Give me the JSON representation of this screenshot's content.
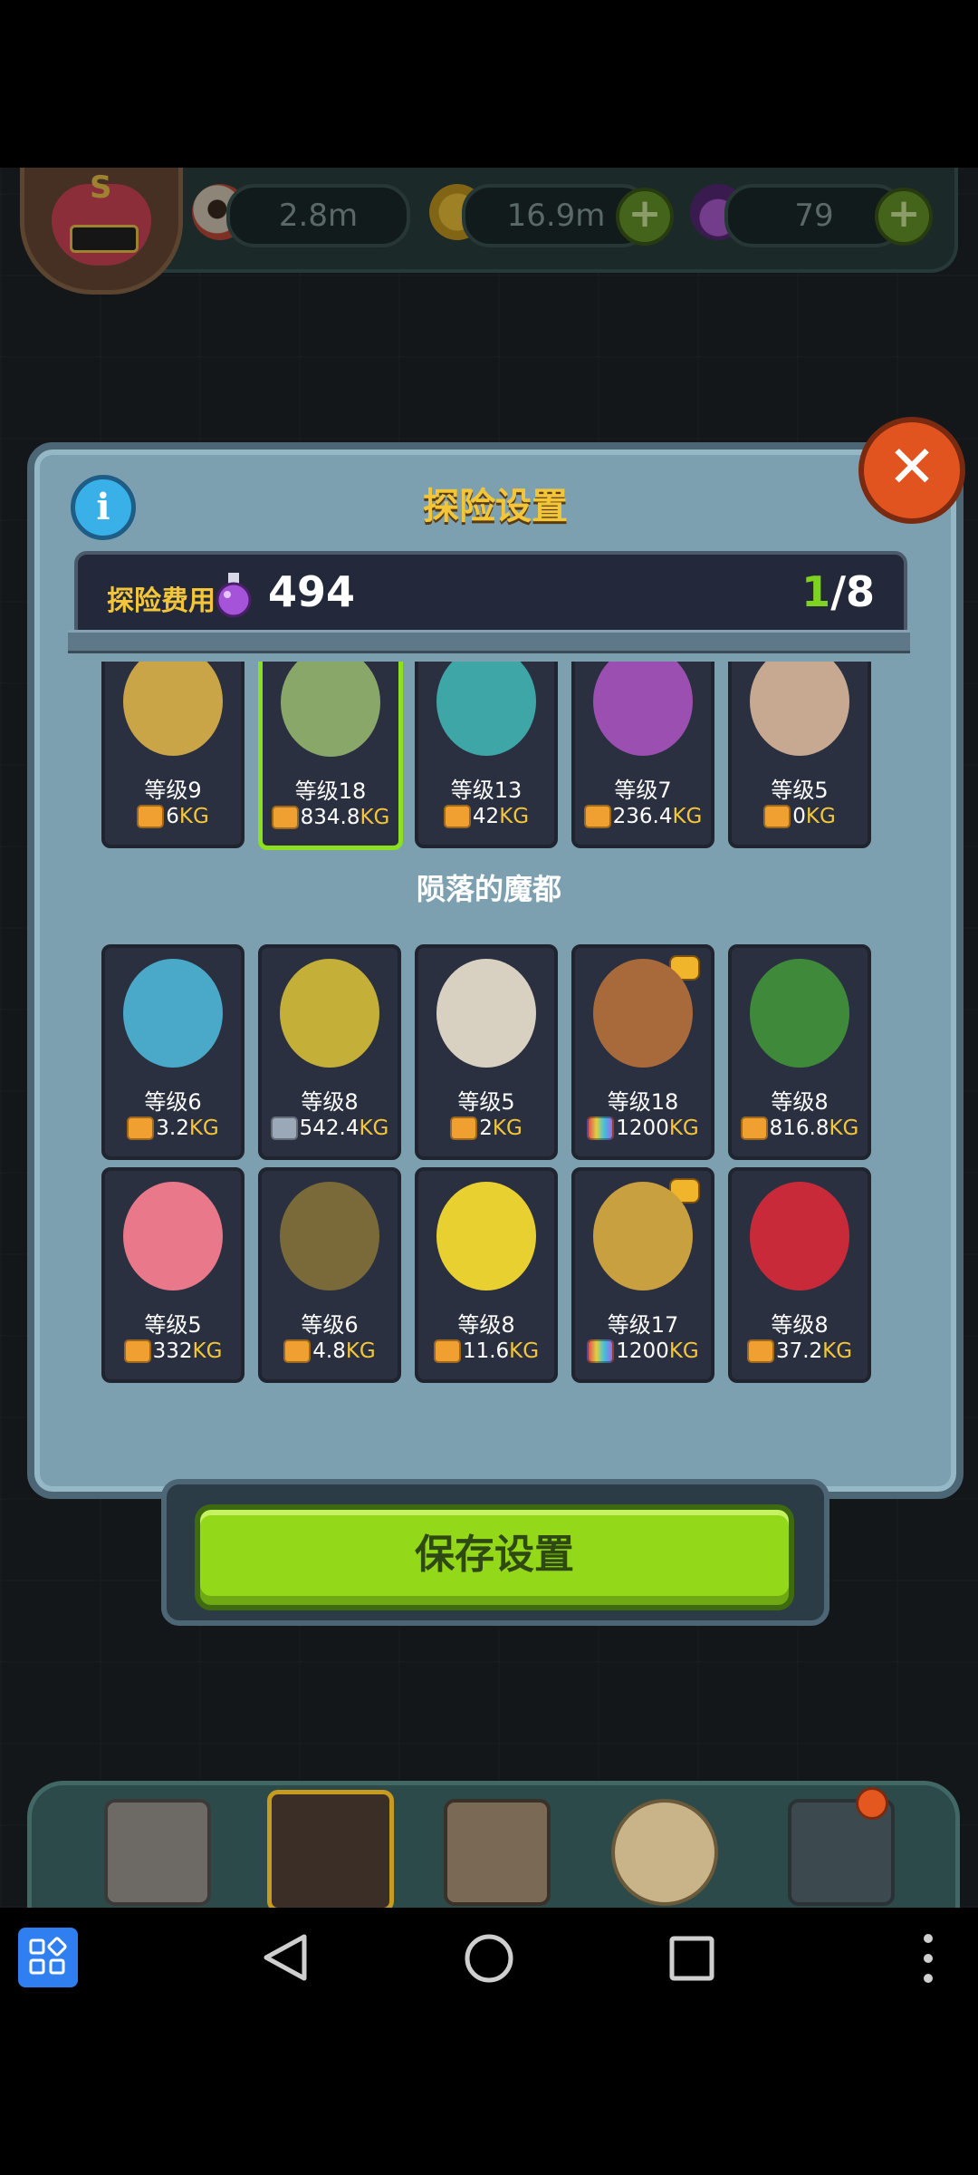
{
  "topbar": {
    "eye_value": "2.8m",
    "coin_value": "16.9m",
    "potion_value": "79",
    "plus_symbol": "+"
  },
  "dialog": {
    "title": "探险设置",
    "info_symbol": "i",
    "close_symbol": "✕",
    "cost_label": "探险费用",
    "cost_value": "494",
    "slots_used": "1",
    "slots_total": "/8",
    "save_button": "保存设置"
  },
  "top_row": [
    {
      "level": "等级9",
      "weight": "6",
      "unit": "KG",
      "bag": "#f0a030",
      "color": "#c9a548",
      "selected": false
    },
    {
      "level": "等级18",
      "weight": "834.8",
      "unit": "KG",
      "bag": "#f0a030",
      "color": "#8aa76a",
      "selected": true
    },
    {
      "level": "等级13",
      "weight": "42",
      "unit": "KG",
      "bag": "#f0a030",
      "color": "#3fa6a8",
      "selected": false
    },
    {
      "level": "等级7",
      "weight": "236.4",
      "unit": "KG",
      "bag": "#f0a030",
      "color": "#9b4fb0",
      "selected": false
    },
    {
      "level": "等级5",
      "weight": "0",
      "unit": "KG",
      "bag": "#f0a030",
      "color": "#c7a890",
      "selected": false
    }
  ],
  "section_title": "陨落的魔都",
  "grid_row1": [
    {
      "level": "等级6",
      "weight": "3.2",
      "unit": "KG",
      "bag": "#f0a030",
      "color": "#4aa8c8",
      "tag": false
    },
    {
      "level": "等级8",
      "weight": "542.4",
      "unit": "KG",
      "bag": "#9aa8b8",
      "color": "#c4b038",
      "tag": false
    },
    {
      "level": "等级5",
      "weight": "2",
      "unit": "KG",
      "bag": "#f0a030",
      "color": "#d8d0c0",
      "tag": false
    },
    {
      "level": "等级18",
      "weight": "1200",
      "unit": "KG",
      "bag": "#9a6ae0",
      "color": "#a86a3a",
      "tag": true
    },
    {
      "level": "等级8",
      "weight": "816.8",
      "unit": "KG",
      "bag": "#f0a030",
      "color": "#3f8a3a",
      "tag": false
    }
  ],
  "grid_row2": [
    {
      "level": "等级5",
      "weight": "332",
      "unit": "KG",
      "bag": "#f0a030",
      "color": "#e8788a",
      "tag": false
    },
    {
      "level": "等级6",
      "weight": "4.8",
      "unit": "KG",
      "bag": "#f0a030",
      "color": "#7a6a3a",
      "tag": false
    },
    {
      "level": "等级8",
      "weight": "11.6",
      "unit": "KG",
      "bag": "#f0a030",
      "color": "#e8d030",
      "tag": false
    },
    {
      "level": "等级17",
      "weight": "1200",
      "unit": "KG",
      "bag": "#9a6ae0",
      "color": "#c8a040",
      "tag": true
    },
    {
      "level": "等级8",
      "weight": "37.2",
      "unit": "KG",
      "bag": "#f0a030",
      "color": "#c82a3a",
      "tag": false
    }
  ],
  "colors": {
    "accent_gold": "#f3c63a",
    "selected_green": "#8be01f",
    "save_green": "#94d81a"
  },
  "icons": [
    "eye-icon",
    "coin-icon",
    "potion-icon",
    "info-icon",
    "close-icon",
    "weight-bag-icon",
    "shop-icon",
    "dungeon-icon",
    "book-icon",
    "loot-bag-icon",
    "grid-icon",
    "apps-icon",
    "back-icon",
    "home-icon",
    "recents-icon",
    "more-icon"
  ]
}
